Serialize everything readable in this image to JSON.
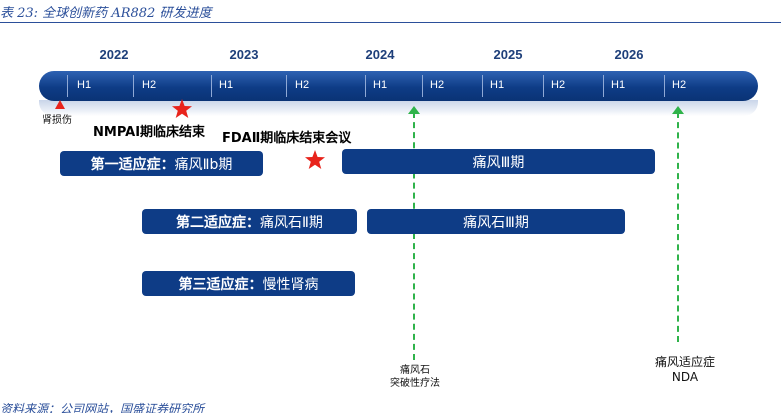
{
  "caption": {
    "title": "表 23:  全球创新药 AR882 研发进度",
    "source": "资料来源：公司网站，国盛证券研究所"
  },
  "colors": {
    "bar": "#0e3c86",
    "box": "#0e3c86",
    "milestone": "#2fb34a",
    "star": "#e8231b"
  },
  "timeline": {
    "years": [
      "2022",
      "2023",
      "2024",
      "2025",
      "2026"
    ],
    "halves": [
      "H1",
      "H2",
      "H1",
      "H2",
      "H1",
      "H2",
      "H1",
      "H2",
      "H1",
      "H2"
    ]
  },
  "events": {
    "kidney_injury": "肾损伤",
    "nmpa": "NMPAⅠ期临床结束",
    "fda": "FDAⅡ期临床结束会议"
  },
  "indications": [
    {
      "label": "第一适应症：",
      "phase_label": "痛风Ⅱb期",
      "next_phase": "痛风Ⅲ期"
    },
    {
      "label": "第二适应症：",
      "phase_label": "痛风石Ⅱ期",
      "next_phase": "痛风石Ⅲ期"
    },
    {
      "label": "第三适应症：",
      "phase_label": "慢性肾病"
    }
  ],
  "milestones": [
    {
      "line1": "痛风石",
      "line2": "突破性疗法"
    },
    {
      "line1": "痛风适应症",
      "line2": "NDA"
    }
  ]
}
